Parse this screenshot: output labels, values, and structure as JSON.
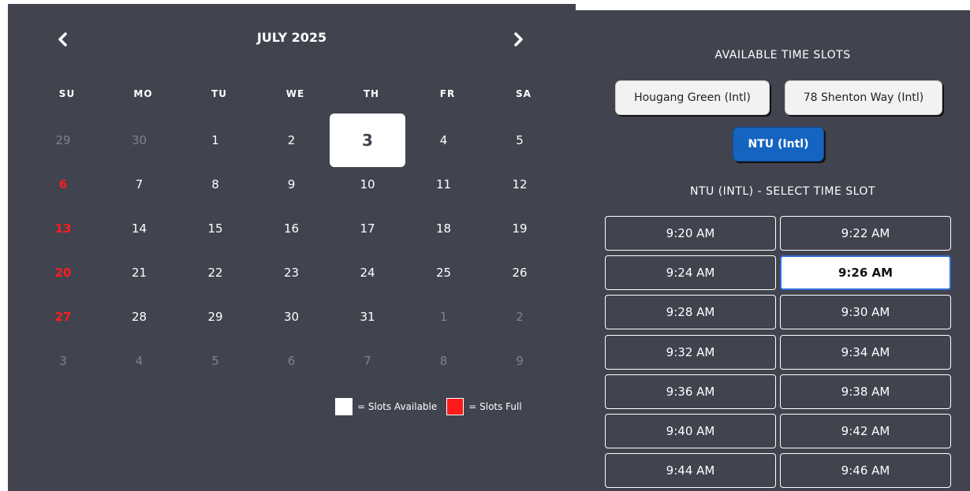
{
  "calendar": {
    "month_title": "JULY 2025",
    "prev_icon": "chevron-left-icon",
    "next_icon": "chevron-right-icon",
    "weekdays": [
      "SU",
      "MO",
      "TU",
      "WE",
      "TH",
      "FR",
      "SA"
    ],
    "weeks": [
      [
        {
          "d": "29",
          "s": "muted"
        },
        {
          "d": "30",
          "s": "muted"
        },
        {
          "d": "1",
          "s": "avail"
        },
        {
          "d": "2",
          "s": "avail"
        },
        {
          "d": "3",
          "s": "selected"
        },
        {
          "d": "4",
          "s": "avail"
        },
        {
          "d": "5",
          "s": "avail"
        }
      ],
      [
        {
          "d": "6",
          "s": "full"
        },
        {
          "d": "7",
          "s": "avail"
        },
        {
          "d": "8",
          "s": "avail"
        },
        {
          "d": "9",
          "s": "avail"
        },
        {
          "d": "10",
          "s": "avail"
        },
        {
          "d": "11",
          "s": "avail"
        },
        {
          "d": "12",
          "s": "avail"
        }
      ],
      [
        {
          "d": "13",
          "s": "full"
        },
        {
          "d": "14",
          "s": "avail"
        },
        {
          "d": "15",
          "s": "avail"
        },
        {
          "d": "16",
          "s": "avail"
        },
        {
          "d": "17",
          "s": "avail"
        },
        {
          "d": "18",
          "s": "avail"
        },
        {
          "d": "19",
          "s": "avail"
        }
      ],
      [
        {
          "d": "20",
          "s": "full"
        },
        {
          "d": "21",
          "s": "avail"
        },
        {
          "d": "22",
          "s": "avail"
        },
        {
          "d": "23",
          "s": "avail"
        },
        {
          "d": "24",
          "s": "avail"
        },
        {
          "d": "25",
          "s": "avail"
        },
        {
          "d": "26",
          "s": "avail"
        }
      ],
      [
        {
          "d": "27",
          "s": "full"
        },
        {
          "d": "28",
          "s": "avail"
        },
        {
          "d": "29",
          "s": "avail"
        },
        {
          "d": "30",
          "s": "avail"
        },
        {
          "d": "31",
          "s": "avail"
        },
        {
          "d": "1",
          "s": "muted"
        },
        {
          "d": "2",
          "s": "muted"
        }
      ],
      [
        {
          "d": "3",
          "s": "muted"
        },
        {
          "d": "4",
          "s": "muted"
        },
        {
          "d": "5",
          "s": "muted"
        },
        {
          "d": "6",
          "s": "muted"
        },
        {
          "d": "7",
          "s": "muted"
        },
        {
          "d": "8",
          "s": "muted"
        },
        {
          "d": "9",
          "s": "muted"
        }
      ]
    ],
    "legend": {
      "available_label": "= Slots Available",
      "full_label": "= Slots Full"
    }
  },
  "slots_panel": {
    "title": "AVAILABLE TIME SLOTS",
    "locations": [
      {
        "label": "Hougang Green (Intl)"
      },
      {
        "label": "78 Shenton Way (Intl)"
      },
      {
        "label": "NTU (Intl)"
      }
    ],
    "select_title": "NTU (INTL) - SELECT TIME SLOT",
    "times": [
      "9:20 AM",
      "9:22 AM",
      "9:24 AM",
      "9:26 AM",
      "9:28 AM",
      "9:30 AM",
      "9:32 AM",
      "9:34 AM",
      "9:36 AM",
      "9:38 AM",
      "9:40 AM",
      "9:42 AM",
      "9:44 AM",
      "9:46 AM"
    ],
    "selected_time": "9:26 AM"
  },
  "colors": {
    "panel_bg": "#41434f",
    "full_day": "#ff1d1d",
    "accent_blue": "#1565c0",
    "muted_day": "#7f8191"
  }
}
